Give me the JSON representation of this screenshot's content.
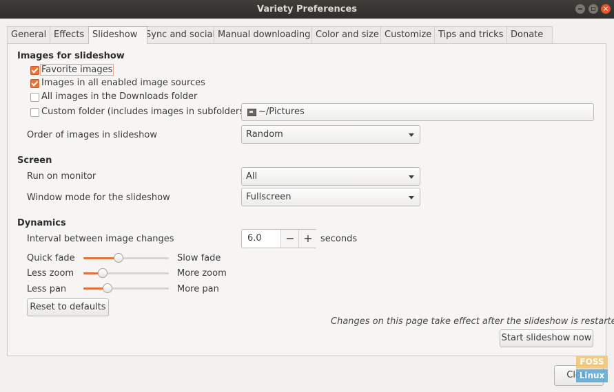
{
  "window": {
    "title": "Variety Preferences"
  },
  "tabs": [
    {
      "label": "General"
    },
    {
      "label": "Effects"
    },
    {
      "label": "Slideshow"
    },
    {
      "label": "Sync and social"
    },
    {
      "label": "Manual downloading"
    },
    {
      "label": "Color and size"
    },
    {
      "label": "Customize"
    },
    {
      "label": "Tips and tricks"
    },
    {
      "label": "Donate"
    }
  ],
  "active_tab": "Slideshow",
  "images_section": {
    "title": "Images for slideshow",
    "options": [
      {
        "label": "Favorite images",
        "checked": true
      },
      {
        "label": "Images in all enabled image sources",
        "checked": true
      },
      {
        "label": "All images in the Downloads folder",
        "checked": false
      },
      {
        "label": "Custom folder (includes images in subfolders)",
        "checked": false
      }
    ],
    "folder_value": "~/Pictures",
    "order_label": "Order of images in slideshow",
    "order_value": "Random"
  },
  "screen_section": {
    "title": "Screen",
    "monitor_label": "Run on monitor",
    "monitor_value": "All",
    "window_mode_label": "Window mode for the slideshow",
    "window_mode_value": "Fullscreen"
  },
  "dynamics_section": {
    "title": "Dynamics",
    "interval_label": "Interval between image changes",
    "interval_value": "6.0",
    "interval_unit": "seconds",
    "minus_label": "−",
    "plus_label": "+",
    "sliders": [
      {
        "left": "Quick fade",
        "right": "Slow fade",
        "level": 0.4
      },
      {
        "left": "Less zoom",
        "right": "More zoom",
        "level": 0.19
      },
      {
        "left": "Less pan",
        "right": "More pan",
        "level": 0.25
      }
    ],
    "reset_label": "Reset to defaults"
  },
  "footer": {
    "note": "Changes on this page take effect after the slideshow is restarted",
    "start_label": "Start slideshow now",
    "close_label": "Close"
  },
  "watermark": {
    "top": "FOSS",
    "bottom": "Linux"
  },
  "colors": {
    "accent": "#e9753a",
    "titlebar": "#3a3935",
    "close_button": "#e7552b"
  }
}
